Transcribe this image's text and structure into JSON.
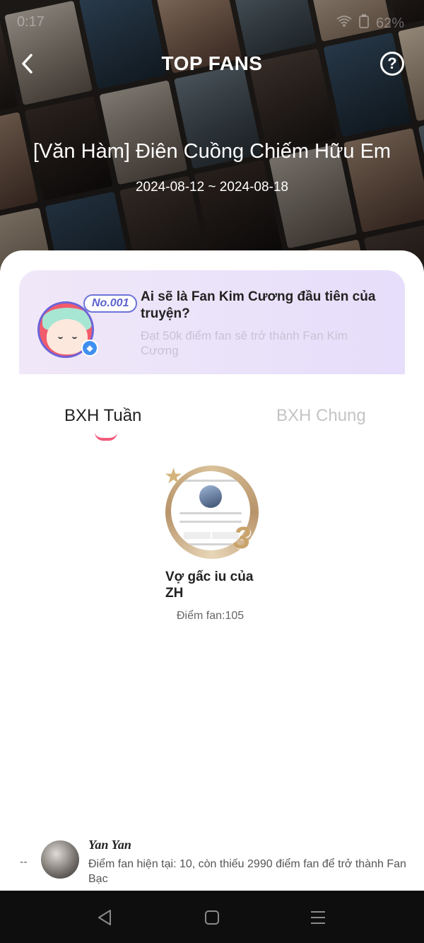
{
  "status_bar": {
    "time": "0:17",
    "battery": "62%"
  },
  "header": {
    "title": "TOP FANS",
    "help_symbol": "?",
    "book_title": "[Văn Hàm] Điên Cuồng Chiếm Hữu Em",
    "date_range": "2024-08-12 ~ 2024-08-18"
  },
  "promo": {
    "badge": "No.001",
    "title": "Ai sẽ là Fan Kim Cương đầu tiên của truyện?",
    "subtitle": "Đạt 50k điểm fan sẽ trở thành Fan Kim Cương"
  },
  "tabs": [
    {
      "label": "BXH Tuần",
      "active": true
    },
    {
      "label": "BXH Chung",
      "active": false
    }
  ],
  "ranking": [
    {
      "rank": "3",
      "name": "Vợ gấc iu của ZH",
      "score": "Điểm fan:105"
    }
  ],
  "me": {
    "rank": "--",
    "name": "Yan Yan",
    "description": "Điểm fan hiện tại: 10, còn thiếu 2990 điểm fan để trở thành Fan Bạc"
  },
  "colors": {
    "accent": "#f25a79",
    "promo_badge": "#5c63cf",
    "rank_gold": "#c9a36a"
  }
}
